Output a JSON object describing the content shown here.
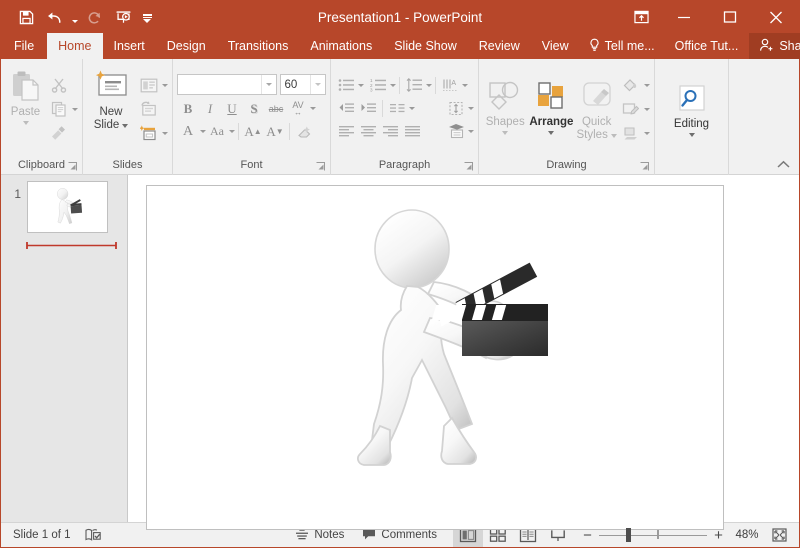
{
  "window": {
    "title": "Presentation1 - PowerPoint",
    "quick_access": [
      {
        "name": "save",
        "label": "Save",
        "icon": "save-icon",
        "disabled": false
      },
      {
        "name": "undo",
        "label": "Undo",
        "icon": "undo-icon",
        "disabled": false,
        "has_dropdown": true
      },
      {
        "name": "redo",
        "label": "Redo",
        "icon": "redo-icon",
        "disabled": true
      },
      {
        "name": "start-slideshow",
        "label": "Start From Beginning",
        "icon": "slideshow-icon",
        "disabled": false
      },
      {
        "name": "customize-qat",
        "label": "Customize Quick Access Toolbar",
        "icon": "chevron-down-icon",
        "disabled": false
      }
    ],
    "controls": {
      "ribbon_display_options": "Ribbon Display Options",
      "minimize": "Minimize",
      "restore": "Restore Down",
      "close": "Close"
    }
  },
  "ribbon": {
    "tabs": [
      {
        "label": "File",
        "active": false
      },
      {
        "label": "Home",
        "active": true
      },
      {
        "label": "Insert",
        "active": false
      },
      {
        "label": "Design",
        "active": false
      },
      {
        "label": "Transitions",
        "active": false
      },
      {
        "label": "Animations",
        "active": false
      },
      {
        "label": "Slide Show",
        "active": false
      },
      {
        "label": "Review",
        "active": false
      },
      {
        "label": "View",
        "active": false
      }
    ],
    "tell_me": "Tell me...",
    "office_tutorials": "Office Tut...",
    "share": "Share",
    "collapse_label": "Collapse the Ribbon",
    "groups": {
      "clipboard": {
        "label": "Clipboard",
        "paste": "Paste",
        "cut": "Cut",
        "copy": "Copy",
        "format_painter": "Format Painter",
        "dialog_launcher": "Clipboard dialog launcher"
      },
      "slides": {
        "label": "Slides",
        "new_slide": "New\nSlide",
        "new_slide_line1": "New",
        "new_slide_line2": "Slide",
        "layout": "Layout",
        "reset": "Reset",
        "section": "Section"
      },
      "font": {
        "label": "Font",
        "font_name_value": "",
        "font_name_placeholder": "",
        "font_size_value": "60",
        "bold": "B",
        "italic": "I",
        "underline": "U",
        "shadow": "S",
        "strikethrough": "abc",
        "character_spacing": "AV",
        "font_color": "A",
        "change_case": "Aa",
        "increase_font": "A",
        "decrease_font": "A",
        "clear_formatting": "Clear All Formatting",
        "dialog_launcher": "Font dialog launcher"
      },
      "paragraph": {
        "label": "Paragraph",
        "bullets": "Bullets",
        "numbering": "Numbering",
        "line_spacing": "Line Spacing",
        "text_direction": "Text Direction",
        "decrease_indent": "Decrease List Level",
        "increase_indent": "Increase List Level",
        "columns": "Columns",
        "align_text": "Align Text",
        "align_left": "Align Left",
        "center": "Center",
        "align_right": "Align Right",
        "justify": "Justify",
        "smartart": "Convert to SmartArt",
        "dialog_launcher": "Paragraph dialog launcher"
      },
      "drawing": {
        "label": "Drawing",
        "shapes": "Shapes",
        "arrange": "Arrange",
        "quick_styles_line1": "Quick",
        "quick_styles_line2": "Styles",
        "shape_fill": "Shape Fill",
        "shape_outline": "Shape Outline",
        "shape_effects": "Shape Effects",
        "dialog_launcher": "Drawing dialog launcher"
      },
      "editing": {
        "label": "Editing",
        "editing": "Editing"
      }
    }
  },
  "slides_pane": {
    "slides": [
      {
        "number": "1",
        "selected": true,
        "content_icon": "clapperboard-figure-image"
      }
    ]
  },
  "slide": {
    "zoom_fit": "Fit slide to current window",
    "content": {
      "image_name": "stick-figure-with-clapperboard-image",
      "description": "3D white stick figure holding a black and white movie clapperboard"
    }
  },
  "status_bar": {
    "slide_count": "Slide 1 of 1",
    "accessibility_label": "Accessibility Checker",
    "notes": "Notes",
    "comments": "Comments",
    "views": [
      {
        "name": "normal-view",
        "label": "Normal",
        "active": true
      },
      {
        "name": "slide-sorter-view",
        "label": "Slide Sorter",
        "active": false
      },
      {
        "name": "reading-view",
        "label": "Reading View",
        "active": false
      },
      {
        "name": "slideshow-view",
        "label": "Slide Show",
        "active": false
      }
    ],
    "zoom_out": "−",
    "zoom_in": "+",
    "zoom_value": "48%",
    "fit_window": "Fit slide to current window"
  },
  "colors": {
    "accent": "#b7472a",
    "share_bg": "#a03d22",
    "ribbon_bg": "#f1f1f1",
    "pane_bg": "#e6e6e6",
    "slide_bg": "#ffffff",
    "accent_orange": "#e8a33d",
    "accent_blue": "#2b71b8"
  }
}
